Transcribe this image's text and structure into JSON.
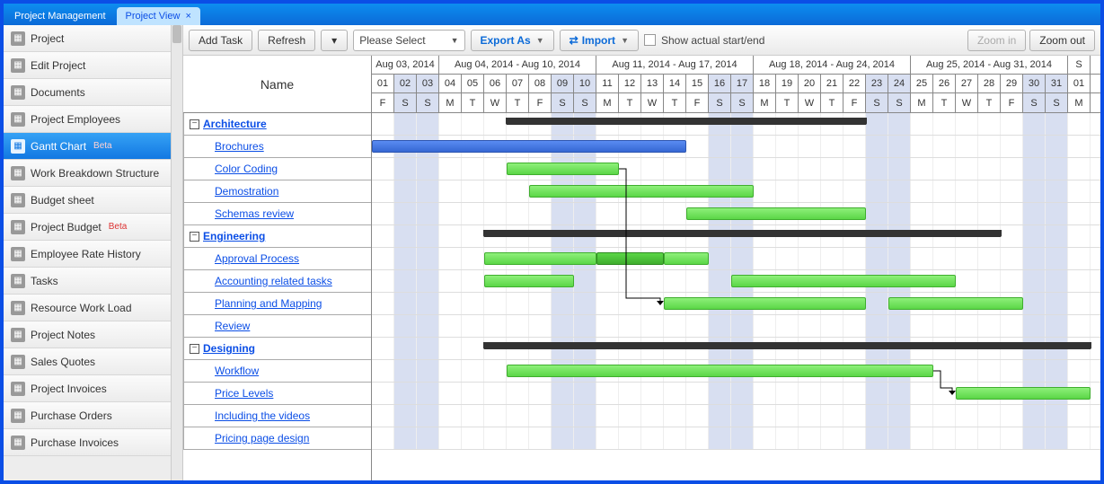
{
  "tabs": [
    {
      "label": "Project Management",
      "active": false
    },
    {
      "label": "Project View",
      "active": true,
      "closable": true
    }
  ],
  "sidebar": {
    "items": [
      {
        "label": "Project"
      },
      {
        "label": "Edit Project"
      },
      {
        "label": "Documents"
      },
      {
        "label": "Project Employees"
      },
      {
        "label": "Gantt Chart",
        "active": true,
        "beta": "Beta"
      },
      {
        "label": "Work Breakdown Structure"
      },
      {
        "label": "Budget sheet"
      },
      {
        "label": "Project Budget",
        "beta": "Beta"
      },
      {
        "label": "Employee Rate History"
      },
      {
        "label": "Tasks"
      },
      {
        "label": "Resource Work Load"
      },
      {
        "label": "Project Notes"
      },
      {
        "label": "Sales Quotes"
      },
      {
        "label": "Project Invoices"
      },
      {
        "label": "Purchase Orders"
      },
      {
        "label": "Purchase Invoices"
      }
    ]
  },
  "toolbar": {
    "add_task": "Add Task",
    "refresh": "Refresh",
    "select_placeholder": "Please Select",
    "export_as": "Export As",
    "import": "Import",
    "show_actual": "Show actual start/end",
    "zoom_in": "Zoom in",
    "zoom_out": "Zoom out"
  },
  "gantt": {
    "name_header": "Name",
    "weeks": [
      {
        "label": "Aug 03, 2014",
        "span": 3
      },
      {
        "label": "Aug 04, 2014 - Aug 10, 2014",
        "span": 7
      },
      {
        "label": "Aug 11, 2014 - Aug 17, 2014",
        "span": 7
      },
      {
        "label": "Aug 18, 2014 - Aug 24, 2014",
        "span": 7
      },
      {
        "label": "Aug 25, 2014 - Aug 31, 2014",
        "span": 7
      },
      {
        "label": "S",
        "span": 1
      }
    ],
    "days": [
      "01",
      "02",
      "03",
      "04",
      "05",
      "06",
      "07",
      "08",
      "09",
      "10",
      "11",
      "12",
      "13",
      "14",
      "15",
      "16",
      "17",
      "18",
      "19",
      "20",
      "21",
      "22",
      "23",
      "24",
      "25",
      "26",
      "27",
      "28",
      "29",
      "30",
      "31",
      "01"
    ],
    "dow": [
      "F",
      "S",
      "S",
      "M",
      "T",
      "W",
      "T",
      "F",
      "S",
      "S",
      "M",
      "T",
      "W",
      "T",
      "F",
      "S",
      "S",
      "M",
      "T",
      "W",
      "T",
      "F",
      "S",
      "S",
      "M",
      "T",
      "W",
      "T",
      "F",
      "S",
      "S",
      "M"
    ],
    "weekend_idx": [
      1,
      2,
      8,
      9,
      15,
      16,
      22,
      23,
      29,
      30
    ],
    "rows": [
      {
        "type": "group",
        "label": "Architecture",
        "summary": {
          "startDay": 6,
          "endDay": 22
        }
      },
      {
        "type": "child",
        "label": "Brochures",
        "bars": [
          {
            "cls": "blue",
            "startDay": 0,
            "endDay": 14
          }
        ]
      },
      {
        "type": "child",
        "label": "Color Coding",
        "bars": [
          {
            "cls": "green",
            "startDay": 6,
            "endDay": 11
          }
        ]
      },
      {
        "type": "child",
        "label": "Demostration",
        "bars": [
          {
            "cls": "green",
            "startDay": 7,
            "endDay": 17
          }
        ]
      },
      {
        "type": "child",
        "label": "Schemas review",
        "bars": [
          {
            "cls": "green",
            "startDay": 14,
            "endDay": 22
          }
        ]
      },
      {
        "type": "group",
        "label": "Engineering",
        "summary": {
          "startDay": 5,
          "endDay": 28
        }
      },
      {
        "type": "child",
        "label": "Approval Process",
        "bars": [
          {
            "cls": "green",
            "startDay": 5,
            "endDay": 10
          },
          {
            "cls": "greenalt",
            "startDay": 10,
            "endDay": 13
          },
          {
            "cls": "green",
            "startDay": 13,
            "endDay": 15
          }
        ]
      },
      {
        "type": "child",
        "label": "Accounting related tasks",
        "bars": [
          {
            "cls": "green",
            "startDay": 5,
            "endDay": 9
          },
          {
            "cls": "green",
            "startDay": 16,
            "endDay": 26
          }
        ]
      },
      {
        "type": "child",
        "label": "Planning and Mapping",
        "bars": [
          {
            "cls": "green",
            "startDay": 13,
            "endDay": 22
          },
          {
            "cls": "green",
            "startDay": 23,
            "endDay": 29
          }
        ]
      },
      {
        "type": "child",
        "label": "Review"
      },
      {
        "type": "group",
        "label": "Designing",
        "summary": {
          "startDay": 5,
          "endDay": 32
        }
      },
      {
        "type": "child",
        "label": "Workflow",
        "bars": [
          {
            "cls": "green",
            "startDay": 6,
            "endDay": 25
          }
        ]
      },
      {
        "type": "child",
        "label": "Price Levels",
        "bars": [
          {
            "cls": "green",
            "startDay": 26,
            "endDay": 32
          }
        ]
      },
      {
        "type": "child",
        "label": "Including the videos"
      },
      {
        "type": "child",
        "label": "Pricing page design"
      }
    ],
    "dependencies": [
      {
        "fromRow": 2,
        "fromDay": 11,
        "toRow": 8,
        "toDay": 13
      },
      {
        "fromRow": 11,
        "fromDay": 25,
        "toRow": 12,
        "toDay": 26
      }
    ]
  }
}
